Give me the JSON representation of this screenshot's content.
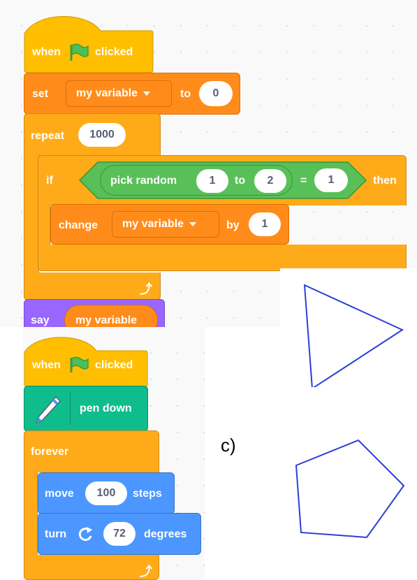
{
  "colors": {
    "events": "#ffbf00",
    "variables": "#ff8c1a",
    "control": "#ffab19",
    "operators": "#59c059",
    "looks": "#9966ff",
    "pen": "#0fbd8c",
    "motion": "#4c97ff",
    "shape_stroke": "#2a3fd6"
  },
  "script1": {
    "hat": {
      "when": "when",
      "flag_icon": "green-flag-icon",
      "clicked": "clicked"
    },
    "set": {
      "label": "set",
      "variable": "my variable",
      "to": "to",
      "value": "0"
    },
    "repeat": {
      "label": "repeat",
      "count": "1000"
    },
    "if": {
      "label": "if",
      "then": "then",
      "condition": {
        "pick": "pick random",
        "from": "1",
        "to": "to",
        "to_value": "2",
        "equals": "=",
        "compare": "1"
      }
    },
    "change": {
      "label": "change",
      "variable": "my variable",
      "by": "by",
      "value": "1"
    },
    "say": {
      "label": "say",
      "value": "my variable"
    }
  },
  "script2": {
    "hat": {
      "when": "when",
      "flag_icon": "green-flag-icon",
      "clicked": "clicked"
    },
    "pen": {
      "label": "pen down",
      "icon": "pen-icon"
    },
    "forever": {
      "label": "forever"
    },
    "move": {
      "label": "move",
      "value": "100",
      "steps": "steps"
    },
    "turn": {
      "label": "turn",
      "icon": "rotate-clockwise-icon",
      "value": "72",
      "degrees": "degrees"
    }
  },
  "caption": "c)",
  "shapes": [
    {
      "name": "triangle",
      "sides": 3
    },
    {
      "name": "pentagon",
      "sides": 5
    }
  ]
}
